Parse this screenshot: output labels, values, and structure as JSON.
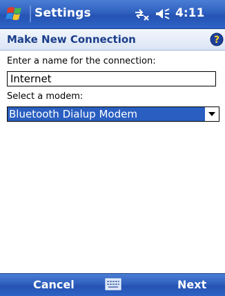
{
  "titlebar": {
    "app_title": "Settings",
    "clock": "4:11",
    "icons": [
      "windows-start-icon",
      "connectivity-icon",
      "volume-icon"
    ]
  },
  "header": {
    "title": "Make New Connection",
    "help_icon": "help-icon"
  },
  "form": {
    "name_label": "Enter a name for the connection:",
    "name_value": "Internet",
    "modem_label": "Select a modem:",
    "modem_selected": "Bluetooth Dialup Modem"
  },
  "softkeys": {
    "left": "Cancel",
    "right": "Next",
    "center_icon": "keyboard-icon"
  },
  "colors": {
    "titlebar": "#2f60bf",
    "header_text": "#1b3e8a",
    "selection": "#2a5fc1"
  }
}
